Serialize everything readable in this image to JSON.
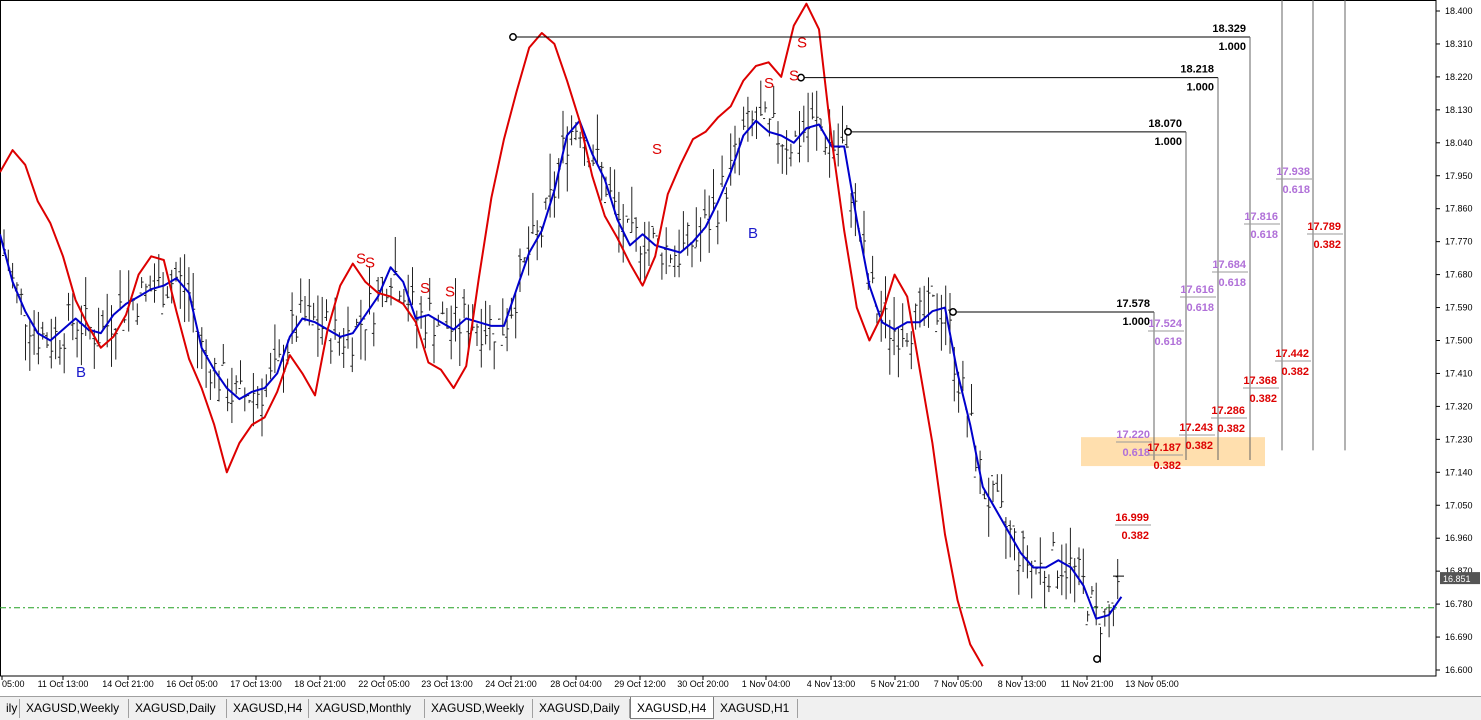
{
  "tabs": [
    {
      "label": "ily"
    },
    {
      "label": "XAGUSD,Weekly"
    },
    {
      "label": "XAGUSD,Daily"
    },
    {
      "label": "XAGUSD,H4"
    },
    {
      "label": "XAGUSD,Monthly"
    },
    {
      "label": "XAGUSD,Weekly"
    },
    {
      "label": "XAGUSD,Daily"
    },
    {
      "label": "XAGUSD,H4",
      "active": true
    },
    {
      "label": "XAGUSD,H1"
    }
  ],
  "chart_data": {
    "type": "candlestick",
    "symbol": "XAGUSD",
    "timeframe": "H4",
    "ylim": [
      16.6,
      18.42
    ],
    "y_ticks": [
      18.4,
      18.31,
      18.22,
      18.13,
      18.04,
      17.95,
      17.86,
      17.77,
      17.68,
      17.59,
      17.5,
      17.41,
      17.32,
      17.23,
      17.14,
      17.05,
      16.96,
      16.87,
      16.78,
      16.69,
      16.6
    ],
    "y_tick_labels": [
      "18.400",
      "18.310",
      "18.220",
      "18.130",
      "18.040",
      "17.950",
      "17.860",
      "17.770",
      "17.680",
      "17.590",
      "17.500",
      "17.410",
      "17.320",
      "17.230",
      "17.140",
      "17.050",
      "16.960",
      "16.870",
      "16.780",
      "16.690",
      "16.600"
    ],
    "x_tick_labels": [
      "05:00",
      "11 Oct 13:00",
      "14 Oct 21:00",
      "16 Oct 05:00",
      "17 Oct 13:00",
      "18 Oct 21:00",
      "22 Oct 05:00",
      "23 Oct 13:00",
      "24 Oct 21:00",
      "28 Oct 04:00",
      "29 Oct 12:00",
      "30 Oct 20:00",
      "1 Nov 04:00",
      "4 Nov 13:00",
      "5 Nov 21:00",
      "7 Nov 05:00",
      "8 Nov 13:00",
      "11 Nov 21:00",
      "13 Nov 05:00"
    ],
    "current_price": 16.851,
    "current_price_label": "16.851",
    "horizontal_line": 16.77,
    "highlight_zone": [
      17.157,
      17.236
    ],
    "swing_highs": [
      {
        "price": 18.329,
        "price_label": "18.329",
        "ratio_label": "1.000"
      },
      {
        "price": 18.218,
        "price_label": "18.218",
        "ratio_label": "1.000"
      },
      {
        "price": 18.07,
        "price_label": "18.070",
        "ratio_label": "1.000"
      },
      {
        "price": 17.578,
        "price_label": "17.578",
        "ratio_label": "1.000"
      }
    ],
    "fib_purple": [
      {
        "price_label": "17.938",
        "ratio_label": "0.618"
      },
      {
        "price_label": "17.816",
        "ratio_label": "0.618"
      },
      {
        "price_label": "17.684",
        "ratio_label": "0.618"
      },
      {
        "price_label": "17.616",
        "ratio_label": "0.618"
      },
      {
        "price_label": "17.524",
        "ratio_label": "0.618"
      },
      {
        "price_label": "17.220",
        "ratio_label": "0.618"
      }
    ],
    "fib_red": [
      {
        "price_label": "17.789",
        "ratio_label": "0.382"
      },
      {
        "price_label": "17.442",
        "ratio_label": "0.382"
      },
      {
        "price_label": "17.368",
        "ratio_label": "0.382"
      },
      {
        "price_label": "17.286",
        "ratio_label": "0.382"
      },
      {
        "price_label": "17.243",
        "ratio_label": "0.382"
      },
      {
        "price_label": "17.187",
        "ratio_label": "0.382"
      },
      {
        "price_label": "16.999",
        "ratio_label": "0.382"
      }
    ],
    "signals": [
      {
        "text": "S",
        "price": 18.3
      },
      {
        "text": "S",
        "price": 18.19
      },
      {
        "text": "S",
        "price": 18.21
      },
      {
        "text": "S",
        "price": 18.01
      },
      {
        "text": "S",
        "price": 17.71
      },
      {
        "text": "S",
        "price": 17.7
      },
      {
        "text": "S",
        "price": 17.63
      },
      {
        "text": "S",
        "price": 17.62
      },
      {
        "text": "B",
        "price": 17.4
      },
      {
        "text": "B",
        "price": 17.78
      }
    ],
    "series": [
      {
        "color": "#0000cc",
        "values": [
          17.79,
          17.66,
          17.58,
          17.52,
          17.5,
          17.53,
          17.56,
          17.53,
          17.52,
          17.57,
          17.6,
          17.62,
          17.64,
          17.65,
          17.67,
          17.63,
          17.48,
          17.42,
          17.37,
          17.34,
          17.36,
          17.37,
          17.41,
          17.51,
          17.56,
          17.55,
          17.53,
          17.51,
          17.52,
          17.57,
          17.62,
          17.7,
          17.66,
          17.56,
          17.57,
          17.55,
          17.53,
          17.56,
          17.55,
          17.54,
          17.54,
          17.64,
          17.74,
          17.8,
          17.91,
          18.06,
          18.1,
          18.01,
          17.94,
          17.83,
          17.76,
          17.79,
          17.76,
          17.75,
          17.74,
          17.77,
          17.81,
          17.88,
          17.96,
          18.06,
          18.1,
          18.07,
          18.06,
          18.04,
          18.08,
          18.09,
          18.03,
          18.03,
          17.83,
          17.65,
          17.55,
          17.53,
          17.55,
          17.55,
          17.58,
          17.59,
          17.41,
          17.27,
          17.1,
          17.04,
          16.98,
          16.92,
          16.88,
          16.88,
          16.9,
          16.88,
          16.83,
          16.74,
          16.75,
          16.8
        ]
      },
      {
        "color": "#dd0000",
        "values": [
          17.96,
          18.02,
          17.98,
          17.88,
          17.82,
          17.73,
          17.61,
          17.54,
          17.48,
          17.51,
          17.57,
          17.68,
          17.73,
          17.72,
          17.58,
          17.45,
          17.37,
          17.27,
          17.14,
          17.22,
          17.27,
          17.29,
          17.36,
          17.46,
          17.41,
          17.35,
          17.53,
          17.65,
          17.71,
          17.66,
          17.63,
          17.62,
          17.6,
          17.55,
          17.44,
          17.42,
          17.37,
          17.43,
          17.67,
          17.89,
          18.05,
          18.18,
          18.3,
          18.34,
          18.31,
          18.21,
          18.1,
          17.95,
          17.84,
          17.78,
          17.71,
          17.65,
          17.73,
          17.9,
          17.98,
          18.05,
          18.07,
          18.11,
          18.14,
          18.21,
          18.25,
          18.26,
          18.22,
          18.36,
          18.42,
          18.35,
          18.05,
          17.8,
          17.59,
          17.5,
          17.57,
          17.68,
          17.62,
          17.42,
          17.22,
          16.97,
          16.79,
          16.67,
          16.61
        ]
      }
    ]
  }
}
